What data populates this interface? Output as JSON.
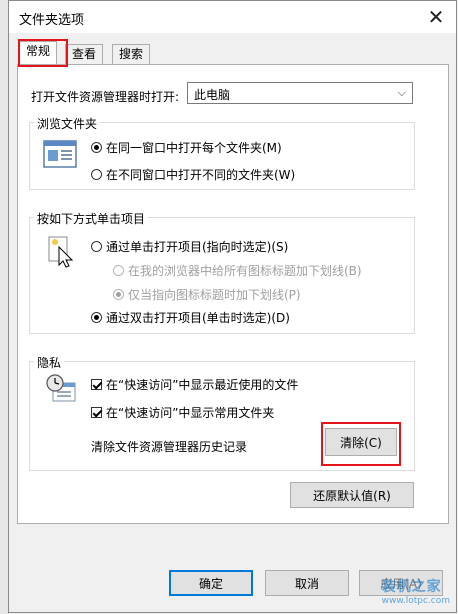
{
  "window": {
    "title": "文件夹选项"
  },
  "tabs": [
    {
      "label": "常规"
    },
    {
      "label": "查看"
    },
    {
      "label": "搜索"
    }
  ],
  "open_in": {
    "label": "打开文件资源管理器时打开:",
    "value": "此电脑"
  },
  "browse": {
    "legend": "浏览文件夹",
    "options": [
      {
        "label": "在同一窗口中打开每个文件夹(M)",
        "checked": true
      },
      {
        "label": "在不同窗口中打开不同的文件夹(W)",
        "checked": false
      }
    ]
  },
  "click": {
    "legend": "按如下方式单击项目",
    "options": [
      {
        "label": "通过单击打开项目(指向时选定)(S)"
      },
      {
        "label": "在我的浏览器中给所有图标标题加下划线(B)"
      },
      {
        "label": "仅当指向图标标题时加下划线(P)"
      },
      {
        "label": "通过双击打开项目(单击时选定)(D)"
      }
    ]
  },
  "privacy": {
    "legend": "隐私",
    "checks": [
      {
        "label": "在“快速访问”中显示最近使用的文件"
      },
      {
        "label": "在“快速访问”中显示常用文件夹"
      }
    ],
    "clear_label": "清除文件资源管理器历史记录",
    "clear_button": "清除(C)"
  },
  "restore_button": "还原默认值(R)",
  "footer": {
    "ok": "确定",
    "cancel": "取消",
    "apply": "应用(A)"
  },
  "watermark": {
    "brand": "装机之家",
    "url": "www.lotpc.com"
  },
  "colors": {
    "highlight": "#e4141b",
    "accent": "#0078d7"
  }
}
